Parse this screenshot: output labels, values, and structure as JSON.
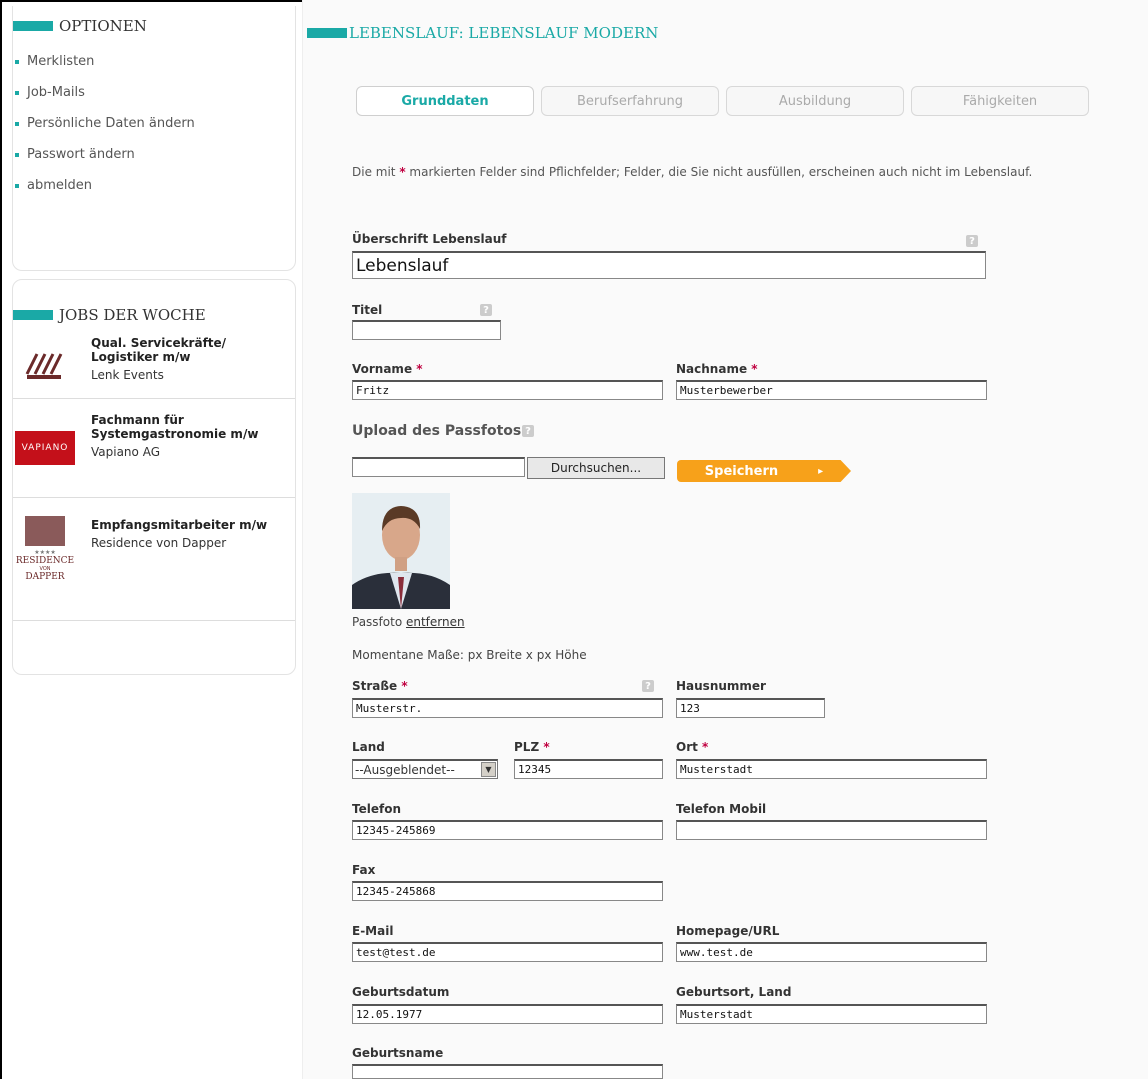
{
  "sidebar": {
    "options_title": "OPTIONEN",
    "options": [
      {
        "label": "Merklisten"
      },
      {
        "label": "Job-Mails"
      },
      {
        "label": "Persönliche Daten ändern"
      },
      {
        "label": "Passwort ändern"
      },
      {
        "label": "abmelden"
      }
    ],
    "jobs_title": "JOBS DER WOCHE",
    "jobs": [
      {
        "title": "Qual. Servicekräfte/ Logistiker m/w",
        "company": "Lenk Events",
        "logo": "lenk-events-logo"
      },
      {
        "title": "Fachmann für Systemgastronomie m/w",
        "company": "Vapiano AG",
        "logo_text": "VAPIANO"
      },
      {
        "title": "Empfangsmitarbeiter m/w",
        "company": "Residence von Dapper",
        "logo_text": "RESIDENCE",
        "logo_sub": "VON",
        "logo_text2": "DAPPER",
        "logo_stars": "★★★★"
      }
    ]
  },
  "main": {
    "title": "LEBENSLAUF: LEBENSLAUF MODERN",
    "tabs": [
      {
        "label": "Grunddaten",
        "active": true
      },
      {
        "label": "Berufserfahrung",
        "active": false
      },
      {
        "label": "Ausbildung",
        "active": false
      },
      {
        "label": "Fähigkeiten",
        "active": false
      }
    ],
    "note_before": "Die mit ",
    "note_star": "*",
    "note_after": " markierten Felder sind Pflichfelder; Felder, die Sie nicht ausfüllen, erscheinen auch nicht im Lebenslauf.",
    "help_glyph": "?",
    "req_mark": "*",
    "fields": {
      "ueberschrift": {
        "label": "Überschrift Lebenslauf",
        "value": "Lebenslauf"
      },
      "titel": {
        "label": "Titel",
        "value": ""
      },
      "vorname": {
        "label": "Vorname",
        "value": "Fritz"
      },
      "nachname": {
        "label": "Nachname",
        "value": "Musterbewerber"
      },
      "upload": {
        "label": "Upload des Passfotos",
        "value": "",
        "browse_label": "Durchsuchen...",
        "save_label": "Speichern",
        "save_chevron": "▸"
      },
      "photo_caption": "Passfoto ",
      "photo_remove": "entfernen",
      "dimensions": "Momentane Maße: px Breite x px Höhe",
      "strasse": {
        "label": "Straße",
        "value": "Musterstr."
      },
      "hausnummer": {
        "label": "Hausnummer",
        "value": "123"
      },
      "land": {
        "label": "Land",
        "value": "--Ausgeblendet--",
        "arrow": "▼"
      },
      "plz": {
        "label": "PLZ",
        "value": "12345"
      },
      "ort": {
        "label": "Ort",
        "value": "Musterstadt"
      },
      "telefon": {
        "label": "Telefon",
        "value": "12345-245869"
      },
      "telefon_mobil": {
        "label": "Telefon Mobil",
        "value": ""
      },
      "fax": {
        "label": "Fax",
        "value": "12345-245868"
      },
      "email": {
        "label": "E-Mail",
        "value": "test@test.de"
      },
      "homepage": {
        "label": "Homepage/URL",
        "value": "www.test.de"
      },
      "geburtsdatum": {
        "label": "Geburtsdatum",
        "value": "12.05.1977"
      },
      "geburtsort": {
        "label": "Geburtsort, Land",
        "value": "Musterstadt"
      },
      "geburtsname": {
        "label": "Geburtsname",
        "value": ""
      }
    }
  },
  "colors": {
    "accent": "#1aa9a6",
    "required": "#c00040",
    "save_button": "#f7a11a"
  }
}
